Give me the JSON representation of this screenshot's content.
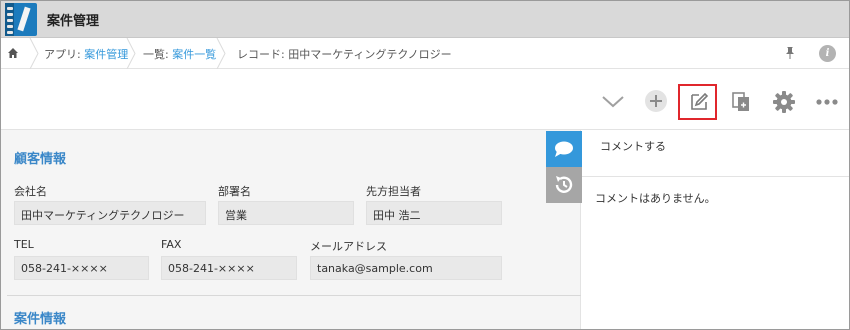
{
  "header": {
    "app_title": "案件管理",
    "app_icon": "notebook-icon"
  },
  "breadcrumb": {
    "home_icon": "home-icon",
    "items": [
      {
        "prefix": "アプリ: ",
        "link": "案件管理"
      },
      {
        "prefix": "一覧: ",
        "link": "案件一覧"
      },
      {
        "prefix": "レコード: ",
        "link": "",
        "text": "田中マーケティングテクノロジー"
      }
    ],
    "info_label": "i"
  },
  "toolbar": {
    "icons": [
      "chevron-down-icon",
      "add-icon",
      "edit-icon",
      "duplicate-icon",
      "gear-icon",
      "more-icon"
    ],
    "highlight_color": "#e0262c"
  },
  "record": {
    "section1_title": "顧客情報",
    "section2_title": "案件情報",
    "fields": {
      "company": {
        "label": "会社名",
        "value": "田中マーケティングテクノロジー"
      },
      "department": {
        "label": "部署名",
        "value": "営業"
      },
      "contact": {
        "label": "先方担当者",
        "value": "田中 浩二"
      },
      "tel": {
        "label": "TEL",
        "value": "058-241-××××"
      },
      "fax": {
        "label": "FAX",
        "value": "058-241-××××"
      },
      "email": {
        "label": "メールアドレス",
        "value": "tanaka@sample.com"
      }
    }
  },
  "side_tabs": {
    "comment_icon": "comment-icon",
    "history_icon": "history-icon",
    "accent": "#3498db"
  },
  "comments": {
    "input_placeholder": "コメントする",
    "empty_text": "コメントはありません。"
  }
}
